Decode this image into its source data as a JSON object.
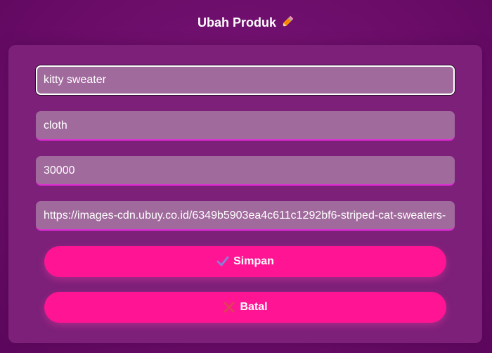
{
  "header": {
    "title": "Ubah Produk",
    "title_icon": "pencil-icon"
  },
  "form": {
    "name_value": "kitty sweater",
    "category_value": "cloth",
    "price_value": "30000",
    "image_url_value": "https://images-cdn.ubuy.co.id/6349b5903ea4c611c1292bf6-striped-cat-sweaters-"
  },
  "buttons": {
    "save_label": "Simpan",
    "save_icon": "checkmark-icon",
    "cancel_label": "Batal",
    "cancel_icon": "cross-icon"
  },
  "colors": {
    "background": "#6c0d6a",
    "card": "#7d2079",
    "input": "#a06a9c",
    "input_underline": "#e02ad6",
    "button": "#ff1493"
  }
}
